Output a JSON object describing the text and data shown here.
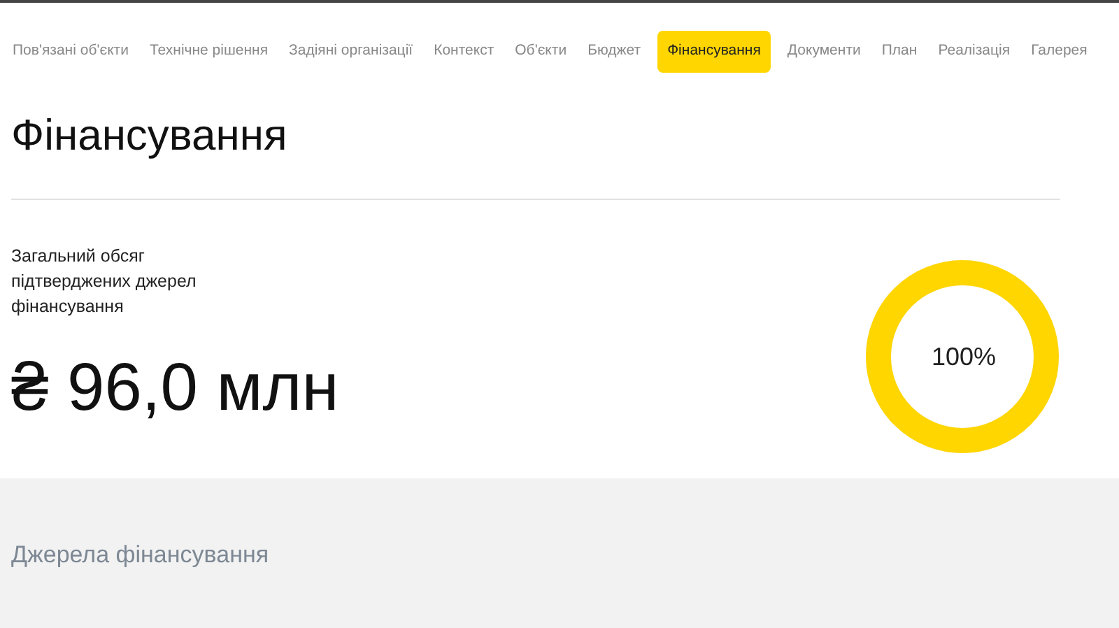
{
  "tabs": [
    {
      "label": "Пов'язані об'єкти",
      "selected": false
    },
    {
      "label": "Технічне рішення",
      "selected": false
    },
    {
      "label": "Задіяні організації",
      "selected": false
    },
    {
      "label": "Контекст",
      "selected": false
    },
    {
      "label": "Об'єкти",
      "selected": false
    },
    {
      "label": "Бюджет",
      "selected": false
    },
    {
      "label": "Фінансування",
      "selected": true
    },
    {
      "label": "Документи",
      "selected": false
    },
    {
      "label": "План",
      "selected": false
    },
    {
      "label": "Реалізація",
      "selected": false
    },
    {
      "label": "Галерея",
      "selected": false
    }
  ],
  "title": "Фінансування",
  "summary": {
    "label": "Загальний обсяг підтверджених джерел фінансування",
    "amount": "₴ 96,0 млн",
    "ring": {
      "level": 1,
      "reading": "100%"
    }
  },
  "sources": {
    "title": "Джерела фінансування"
  }
}
